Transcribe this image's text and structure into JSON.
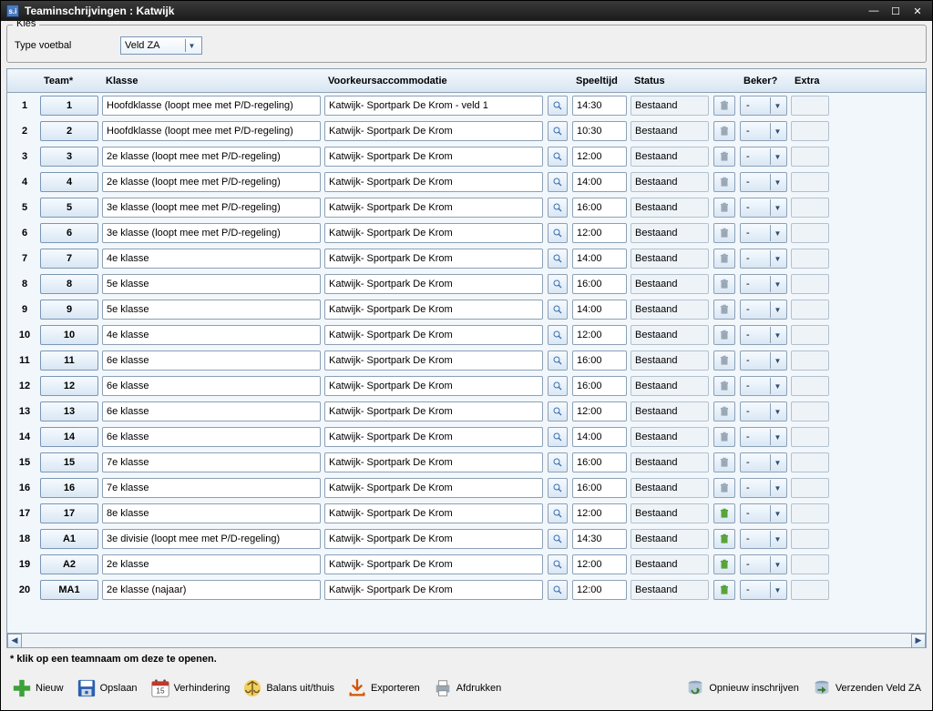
{
  "window": {
    "title": "Teaminschrijvingen : Katwijk"
  },
  "kies": {
    "group_label": "Kies",
    "type_label": "Type voetbal",
    "type_value": "Veld ZA"
  },
  "columns": {
    "team": "Team*",
    "klasse": "Klasse",
    "acc": "Voorkeursaccommodatie",
    "speeltijd": "Speeltijd",
    "status": "Status",
    "beker": "Beker?",
    "extra": "Extra"
  },
  "rows": [
    {
      "n": "1",
      "team": "1",
      "klasse": "Hoofdklasse (loopt mee met P/D-regeling)",
      "acc": "Katwijk- Sportpark De Krom - veld 1",
      "tijd": "14:30",
      "status": "Bestaand",
      "beker": "-",
      "trash": "gray"
    },
    {
      "n": "2",
      "team": "2",
      "klasse": "Hoofdklasse (loopt mee met P/D-regeling)",
      "acc": "Katwijk- Sportpark De Krom",
      "tijd": "10:30",
      "status": "Bestaand",
      "beker": "-",
      "trash": "gray"
    },
    {
      "n": "3",
      "team": "3",
      "klasse": "2e klasse (loopt mee met P/D-regeling)",
      "acc": "Katwijk- Sportpark De Krom",
      "tijd": "12:00",
      "status": "Bestaand",
      "beker": "-",
      "trash": "gray"
    },
    {
      "n": "4",
      "team": "4",
      "klasse": "2e klasse (loopt mee met P/D-regeling)",
      "acc": "Katwijk- Sportpark De Krom",
      "tijd": "14:00",
      "status": "Bestaand",
      "beker": "-",
      "trash": "gray"
    },
    {
      "n": "5",
      "team": "5",
      "klasse": "3e klasse (loopt mee met P/D-regeling)",
      "acc": "Katwijk- Sportpark De Krom",
      "tijd": "16:00",
      "status": "Bestaand",
      "beker": "-",
      "trash": "gray"
    },
    {
      "n": "6",
      "team": "6",
      "klasse": "3e klasse (loopt mee met P/D-regeling)",
      "acc": "Katwijk- Sportpark De Krom",
      "tijd": "12:00",
      "status": "Bestaand",
      "beker": "-",
      "trash": "gray"
    },
    {
      "n": "7",
      "team": "7",
      "klasse": "4e klasse",
      "acc": "Katwijk- Sportpark De Krom",
      "tijd": "14:00",
      "status": "Bestaand",
      "beker": "-",
      "trash": "gray"
    },
    {
      "n": "8",
      "team": "8",
      "klasse": "5e klasse",
      "acc": "Katwijk- Sportpark De Krom",
      "tijd": "16:00",
      "status": "Bestaand",
      "beker": "-",
      "trash": "gray"
    },
    {
      "n": "9",
      "team": "9",
      "klasse": "5e klasse",
      "acc": "Katwijk- Sportpark De Krom",
      "tijd": "14:00",
      "status": "Bestaand",
      "beker": "-",
      "trash": "gray"
    },
    {
      "n": "10",
      "team": "10",
      "klasse": "4e klasse",
      "acc": "Katwijk- Sportpark De Krom",
      "tijd": "12:00",
      "status": "Bestaand",
      "beker": "-",
      "trash": "gray"
    },
    {
      "n": "11",
      "team": "11",
      "klasse": "6e klasse",
      "acc": "Katwijk- Sportpark De Krom",
      "tijd": "16:00",
      "status": "Bestaand",
      "beker": "-",
      "trash": "gray"
    },
    {
      "n": "12",
      "team": "12",
      "klasse": "6e klasse",
      "acc": "Katwijk- Sportpark De Krom",
      "tijd": "16:00",
      "status": "Bestaand",
      "beker": "-",
      "trash": "gray"
    },
    {
      "n": "13",
      "team": "13",
      "klasse": "6e klasse",
      "acc": "Katwijk- Sportpark De Krom",
      "tijd": "12:00",
      "status": "Bestaand",
      "beker": "-",
      "trash": "gray"
    },
    {
      "n": "14",
      "team": "14",
      "klasse": "6e klasse",
      "acc": "Katwijk- Sportpark De Krom",
      "tijd": "14:00",
      "status": "Bestaand",
      "beker": "-",
      "trash": "gray"
    },
    {
      "n": "15",
      "team": "15",
      "klasse": "7e klasse",
      "acc": "Katwijk- Sportpark De Krom",
      "tijd": "16:00",
      "status": "Bestaand",
      "beker": "-",
      "trash": "gray"
    },
    {
      "n": "16",
      "team": "16",
      "klasse": "7e klasse",
      "acc": "Katwijk- Sportpark De Krom",
      "tijd": "16:00",
      "status": "Bestaand",
      "beker": "-",
      "trash": "gray"
    },
    {
      "n": "17",
      "team": "17",
      "klasse": "8e klasse",
      "acc": "Katwijk- Sportpark De Krom",
      "tijd": "12:00",
      "status": "Bestaand",
      "beker": "-",
      "trash": "green"
    },
    {
      "n": "18",
      "team": "A1",
      "klasse": "3e divisie (loopt mee met P/D-regeling)",
      "acc": "Katwijk- Sportpark De Krom",
      "tijd": "14:30",
      "status": "Bestaand",
      "beker": "-",
      "trash": "green"
    },
    {
      "n": "19",
      "team": "A2",
      "klasse": "2e klasse",
      "acc": "Katwijk- Sportpark De Krom",
      "tijd": "12:00",
      "status": "Bestaand",
      "beker": "-",
      "trash": "green"
    },
    {
      "n": "20",
      "team": "MA1",
      "klasse": "2e klasse (najaar)",
      "acc": "Katwijk- Sportpark De Krom",
      "tijd": "12:00",
      "status": "Bestaand",
      "beker": "-",
      "trash": "green"
    }
  ],
  "hint": "* klik op een teamnaam om deze te openen.",
  "toolbar": {
    "nieuw": "Nieuw",
    "opslaan": "Opslaan",
    "verhindering": "Verhindering",
    "balans": "Balans uit/thuis",
    "exporteren": "Exporteren",
    "afdrukken": "Afdrukken",
    "opnieuw": "Opnieuw inschrijven",
    "verzenden": "Verzenden Veld ZA"
  }
}
